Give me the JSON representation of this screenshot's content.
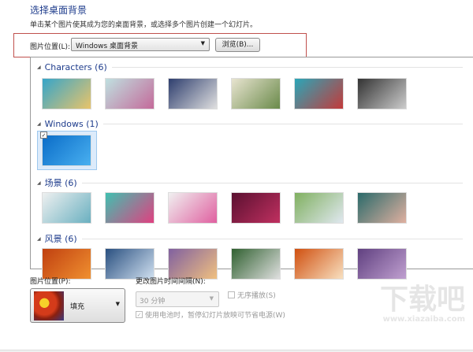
{
  "header": {
    "title": "选择桌面背景",
    "subtitle": "单击某个图片使其成为您的桌面背景，或选择多个图片创建一个幻灯片。"
  },
  "location": {
    "label": "图片位置(L):",
    "value": "Windows 桌面背景",
    "browse": "浏览(B)..."
  },
  "groups": [
    {
      "name": "Characters (6)",
      "thumbs": [
        [
          "#36a5c9",
          "#e9c46a"
        ],
        [
          "#bfe0e0",
          "#c46a9a"
        ],
        [
          "#2e3e6e",
          "#e0e0e0"
        ],
        [
          "#e8e4d0",
          "#6a8a4a"
        ],
        [
          "#2aa6b8",
          "#c43a3a"
        ],
        [
          "#333333",
          "#cccccc"
        ]
      ]
    },
    {
      "name": "Windows (1)",
      "thumbs": [
        [
          "#0a6cc8",
          "#49b0f0"
        ]
      ],
      "selected": true
    },
    {
      "name": "场景 (6)",
      "thumbs": [
        [
          "#eef0f0",
          "#6ab0c0"
        ],
        [
          "#40c0b0",
          "#e04080"
        ],
        [
          "#f0f0f0",
          "#e060a0"
        ],
        [
          "#5a1030",
          "#c03060"
        ],
        [
          "#80b060",
          "#e0e8f0"
        ],
        [
          "#2a6a6a",
          "#e0b0a0"
        ]
      ]
    },
    {
      "name": "风景 (6)",
      "thumbs": [
        [
          "#c04010",
          "#f09030"
        ],
        [
          "#2a5080",
          "#d0e0f0"
        ],
        [
          "#8060a0",
          "#f0c080"
        ],
        [
          "#306030",
          "#e0e0e0"
        ],
        [
          "#d05010",
          "#f8e0c0"
        ],
        [
          "#604080",
          "#c0a0d0"
        ]
      ]
    }
  ],
  "bottom": {
    "position_label": "图片位置(P):",
    "position_value": "填充",
    "interval_label": "更改图片时间间隔(N):",
    "interval_value": "30 分钟",
    "shuffle_label": "无序播放(S)",
    "shuffle_checked": false,
    "battery_label": "使用电池时，暂停幻灯片放映可节省电源(W)",
    "battery_checked": true
  },
  "watermark": {
    "logo": "下载吧",
    "url": "www.xiazaiba.com"
  }
}
